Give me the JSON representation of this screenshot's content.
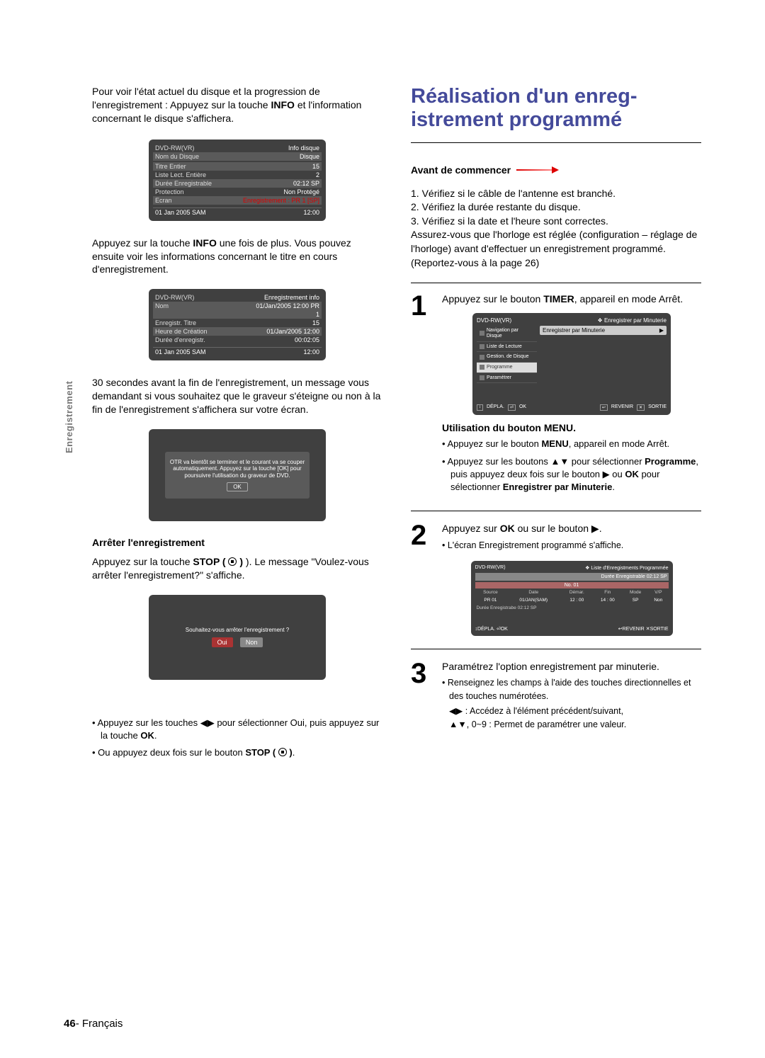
{
  "sideTab": "Enregistrement",
  "left": {
    "intro_1": "Pour voir l'état actuel du disque et la progression de l'enregistrement  : Appuyez sur la touche ",
    "intro_bold": "INFO",
    "intro_2": " et l'information concernant le disque s'affichera.",
    "osd1": {
      "title": "DVD-RW(VR)",
      "rightTitle": "Info disque",
      "rows": [
        {
          "k": "Nom du Disque",
          "v": "Disque"
        },
        {
          "k": "",
          "v": ""
        },
        {
          "k": "Titre Entier",
          "v": "15"
        },
        {
          "k": "Liste Lect. Entière",
          "v": "2"
        },
        {
          "k": "Durée Enregistrable",
          "v": "02:12  SP"
        },
        {
          "k": "Protection",
          "v": "Non Protégé"
        },
        {
          "k": "Ecran",
          "v": "Enregistrement : PR 1 [SP]"
        }
      ],
      "footerL": "01 Jan 2005 SAM",
      "footerR": "12:00"
    },
    "para2_pre": "Appuyez sur la touche ",
    "para2_bold": "INFO",
    "para2_post": " une fois de plus. Vous pouvez ensuite voir les informations concernant le titre en cours d'enregistrement.",
    "osd2": {
      "title": "DVD-RW(VR)",
      "rightTitle": "Enregistrement info",
      "rows": [
        {
          "k": "Nom",
          "v": "01/Jan/2005 12:00 PR"
        },
        {
          "k": "",
          "v": "1"
        },
        {
          "k": "Enregistr. Titre",
          "v": "15"
        },
        {
          "k": "Heure de Création",
          "v": "01/Jan/2005 12:00"
        },
        {
          "k": "Durée d'enregistr.",
          "v": "00:02:05"
        }
      ],
      "footerL": "01 Jan 2005 SAM",
      "footerR": "12:00"
    },
    "para3": "30 secondes avant la fin de l'enregistrement, un message vous demandant si vous souhaitez que le graveur s'éteigne ou non à la fin de l'enregistrement s'affichera sur votre écran.",
    "otr_msg": "OTR va bientôt se terminer et le courant va se couper automatiquement. Appuyez sur la touche [OK] pour poursuivre l'utilisation du graveur de DVD.",
    "otr_ok": "OK",
    "stop_heading": "Arrêter l'enregistrement",
    "stop_para_pre": "Appuyez sur la touche ",
    "stop_para_bold": "STOP ( ",
    "stop_para_post": " ). Le message \"Voulez-vous arrêter l'enregistrement?\" s'affiche.",
    "stop_osd_q": "Souhaitez-vous arrêter l'enregistrement ?",
    "stop_yes": "Oui",
    "stop_no": "Non",
    "bul1_pre": "Appuyez sur les touches ",
    "bul1_post": " pour sélectionner Oui, puis appuyez sur la touche ",
    "bul1_ok": "OK",
    "bul2_pre": "Ou appuyez deux fois sur le bouton ",
    "bul2_bold": "STOP ( "
  },
  "right": {
    "title": "Réalisation d'un enreg-\nistrement programmé",
    "avant": "Avant de commencer",
    "checks": [
      "1. Vérifiez si le câble de l'antenne est branché.",
      "2. Vérifiez la durée restante du disque.",
      "3. Vérifiez si la date et l'heure sont correctes."
    ],
    "checks_tail": "Assurez-vous que l'horloge est réglée (configuration – réglage de l'horloge) avant d'effectuer un enregistrement programmé. (Reportez-vous à la page 26)",
    "step1": {
      "num": "1",
      "text_pre": "Appuyez sur le bouton ",
      "text_bold": "TIMER",
      "text_post": ", appareil en mode Arrêt.",
      "osd": {
        "title": "DVD-RW(VR)",
        "crumb": "Enregistrer par Minuterie",
        "side": [
          "Navigation par Disque",
          "Liste de Lecture",
          "Gestion. de Disque",
          "Programme",
          "Paramétrer"
        ],
        "selected": "Enregistrer par Minuterie",
        "footer": [
          "DÉPLA.",
          "OK",
          "REVENIR",
          "SORTIE"
        ]
      },
      "menu_head": "Utilisation du bouton MENU.",
      "mb1_pre": "Appuyez sur le bouton ",
      "mb1_b": "MENU",
      "mb1_post": ", appareil en mode Arrêt.",
      "mb2_pre": "Appuyez sur les boutons ",
      "mb2_mid": " pour sélectionner ",
      "mb2_b1": "Programme",
      "mb2_mid2": ", puis appuyez deux fois sur le bouton ",
      "mb2_mid3": " ou ",
      "mb2_b2": "OK",
      "mb2_mid4": " pour sélectionner ",
      "mb2_b3": "Enregistrer par Minuterie",
      "mb2_end": "."
    },
    "step2": {
      "num": "2",
      "text_pre": "Appuyez sur ",
      "text_b": "OK",
      "text_mid": " ou sur le bouton ",
      "sub": "L'écran Enregistrement programmé s'affiche.",
      "osd": {
        "title": "DVD-RW(VR)",
        "crumb": "Liste d'Enregistments Programmée",
        "band": "Durée Enregistrable 02:12 SP",
        "no": "No. 01",
        "headers": [
          "Source",
          "Date",
          "Démar.",
          "Fin",
          "Mode",
          "V/P"
        ],
        "row": [
          "PR 01",
          "01/JAN(SAM)",
          "12 : 00",
          "14 : 00",
          "SP",
          "Non"
        ],
        "below": "Durée Enregistrabe 02:12 SP",
        "footer": [
          "DÉPLA.",
          "OK",
          "REVENIR",
          "SORTIE"
        ]
      }
    },
    "step3": {
      "num": "3",
      "text": "Paramétrez l'option enregistrement par minuterie.",
      "sub1": "Renseignez les champs à l'aide des touches directionnelles et des touches numérotées.",
      "sub2": " : Accédez à l'élément précédent/suivant,",
      "sub3": ", 0~9 : Permet de paramétrer une valeur."
    }
  },
  "pageNum": "46",
  "pageLabel": "- Français"
}
